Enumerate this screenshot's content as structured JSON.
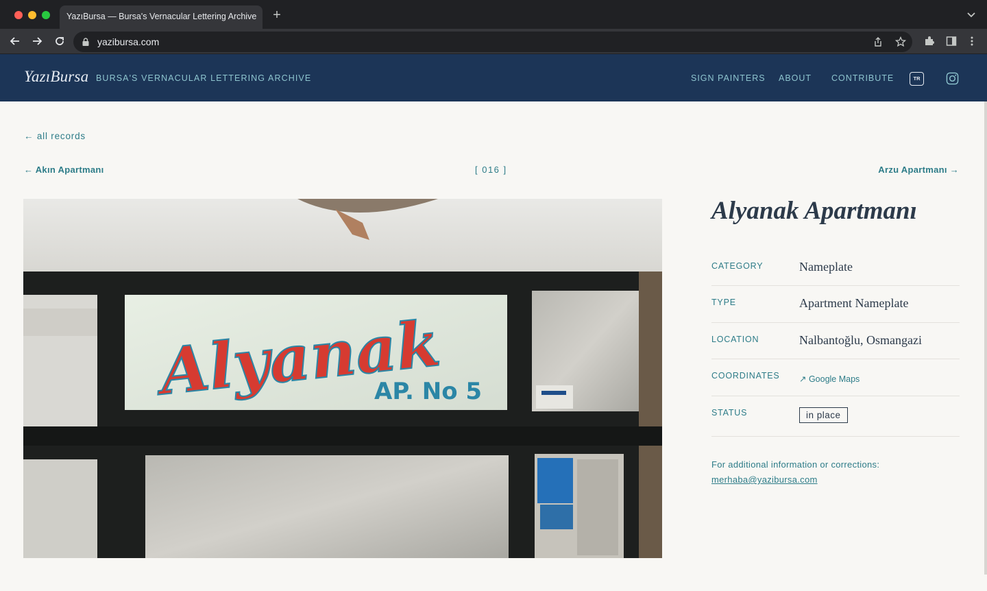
{
  "browser": {
    "tab_title": "YazıBursa — Bursa's Vernacular Lettering Archive",
    "new_tab": "+",
    "url": "yazibursa.com"
  },
  "site": {
    "logo": "YazıBursa",
    "tagline": "BURSA'S VERNACULAR LETTERING ARCHIVE",
    "nav": [
      "SIGN PAINTERS",
      "ABOUT",
      "CONTRIBUTE"
    ],
    "lang": "TR",
    "social_icon": "instagram-icon"
  },
  "page": {
    "back_link": "← all records",
    "prev_link": "← Akın Apartmanı",
    "record_number": "[ 016 ]",
    "next_link": "Arzu Apartmanı →",
    "photo": {
      "sign_script": "Alyanak",
      "sign_sub": "AP. No 5"
    },
    "title": "Alyanak Apartmanı",
    "meta": [
      {
        "label": "CATEGORY",
        "value": "Nameplate"
      },
      {
        "label": "TYPE",
        "value": "Apartment Nameplate"
      },
      {
        "label": "LOCATION",
        "value": "Nalbantoğlu, Osmangazi"
      },
      {
        "label": "COORDINATES",
        "value": "↗ Google Maps"
      },
      {
        "label": "STATUS",
        "value": "in place"
      }
    ],
    "info_note": "For additional information or corrections:",
    "info_email": "merhaba@yazibursa.com"
  },
  "colors": {
    "header_bg": "#1c3557",
    "accent": "#2d7c88",
    "page_bg": "#f8f7f4"
  }
}
